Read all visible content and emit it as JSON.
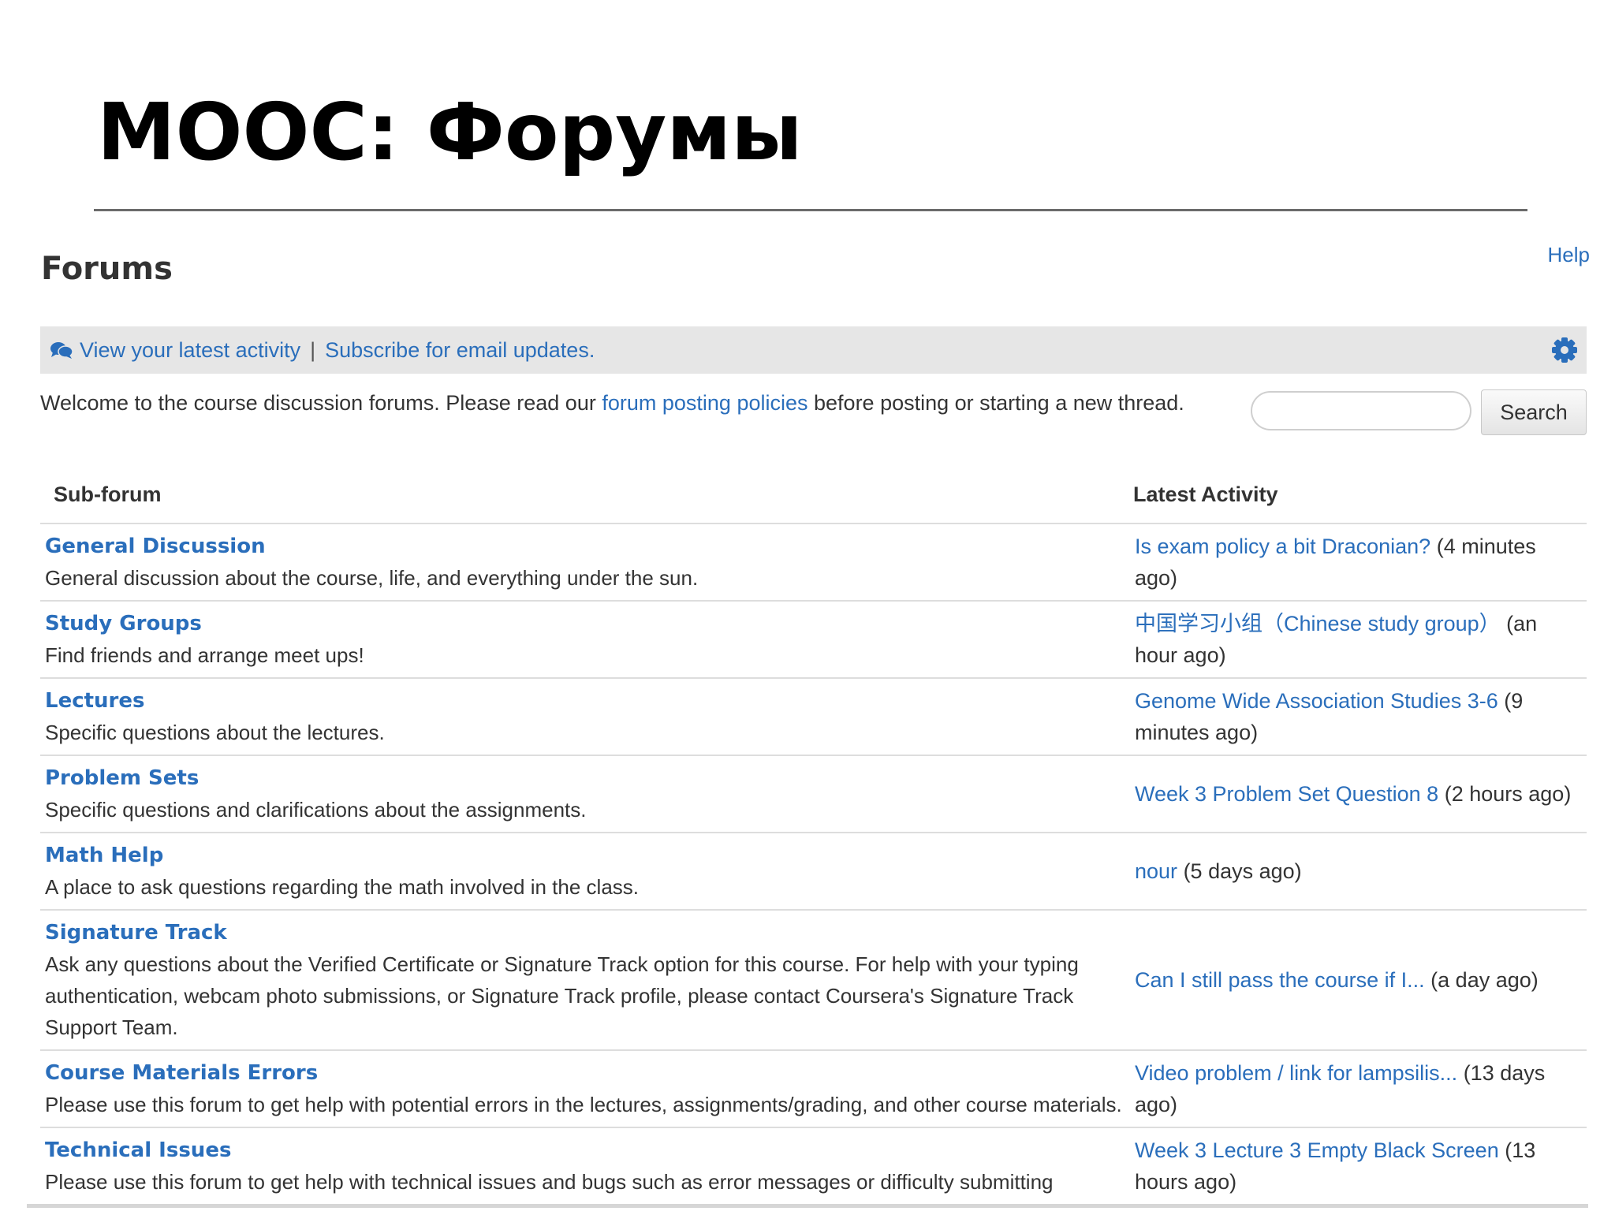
{
  "slide": {
    "title": "MOOC: Форумы"
  },
  "header": {
    "title": "Forums",
    "help_label": "Help"
  },
  "activity_bar": {
    "latest_activity_label": "View your latest activity",
    "separator": "|",
    "subscribe_label": "Subscribe for email updates.",
    "icons": {
      "chat": "chat-bubbles-icon",
      "settings": "gear-icon"
    }
  },
  "welcome": {
    "before": "Welcome to the course discussion forums. Please read our",
    "link": "forum posting policies",
    "after": "before posting or starting a new thread."
  },
  "search": {
    "value": "",
    "placeholder": "",
    "button_label": "Search"
  },
  "table": {
    "col_subforum": "Sub-forum",
    "col_latest": "Latest Activity",
    "rows": [
      {
        "title": "General Discussion",
        "description": "General discussion about the course, life, and everything under the sun.",
        "latest_link": "Is exam policy a bit Draconian?",
        "latest_time": "(4 minutes ago)"
      },
      {
        "title": "Study Groups",
        "description": "Find friends and arrange meet ups!",
        "latest_link": "中国学习小组（Chinese study group）",
        "latest_time": "(an hour ago)"
      },
      {
        "title": "Lectures",
        "description": "Specific questions about the lectures.",
        "latest_link": "Genome Wide Association Studies 3-6",
        "latest_time": "(9 minutes ago)"
      },
      {
        "title": "Problem Sets",
        "description": "Specific questions and clarifications about the assignments.",
        "latest_link": "Week 3 Problem Set Question 8",
        "latest_time": "(2 hours ago)"
      },
      {
        "title": "Math Help",
        "description": "A place to ask questions regarding the math involved in the class.",
        "latest_link": "nour",
        "latest_time": "(5 days ago)"
      },
      {
        "title": "Signature Track",
        "description": "Ask any questions about the Verified Certificate or Signature Track option for this course. For help with your typing authentication, webcam photo submissions, or Signature Track profile, please contact Coursera's Signature Track Support Team.",
        "latest_link": "Can I still pass the course if I...",
        "latest_time": "(a day ago)"
      },
      {
        "title": "Course Materials Errors",
        "description": "Please use this forum to get help with potential errors in the lectures, assignments/grading, and other course materials.",
        "latest_link": "Video problem / link for lampsilis...",
        "latest_time": "(13 days ago)"
      },
      {
        "title": "Technical Issues",
        "description": "Please use this forum to get help with technical issues and bugs such as error messages or difficulty submitting",
        "latest_link": "Week 3 Lecture 3 Empty Black Screen",
        "latest_time": "(13 hours ago)"
      }
    ]
  },
  "colors": {
    "link": "#2a6ebb",
    "text": "#333333",
    "bar": "#e6e6e6",
    "rule": "#6b6b6b"
  }
}
